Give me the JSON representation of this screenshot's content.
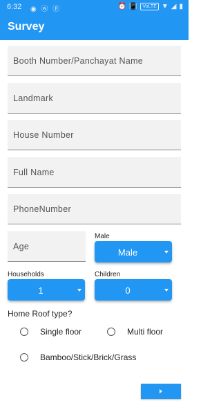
{
  "status": {
    "time": "6:32",
    "left_icons": "◉ ⓦ ⓟ",
    "right_icons": [
      "⏰",
      "📳",
      "VoLTE",
      "▼",
      "◢",
      "▮"
    ]
  },
  "appbar": {
    "title": "Survey",
    "color": "#2196f3"
  },
  "fields": {
    "booth": {
      "placeholder": "Booth Number/Panchayat Name"
    },
    "landmark": {
      "placeholder": "Landmark"
    },
    "house_number": {
      "placeholder": "House Number"
    },
    "full_name": {
      "placeholder": "Full Name"
    },
    "phone": {
      "placeholder": "PhoneNumber"
    },
    "age": {
      "placeholder": "Age"
    }
  },
  "gender": {
    "label": "Male",
    "value": "Male"
  },
  "households": {
    "label": "Households",
    "value": "1"
  },
  "children": {
    "label": "Children",
    "value": "0"
  },
  "roof": {
    "question": "Home Roof type?",
    "options": [
      "Single floor",
      "Multi floor",
      "Bamboo/Stick/Brick/Grass"
    ]
  },
  "next_icon": "chevron-right-icon"
}
